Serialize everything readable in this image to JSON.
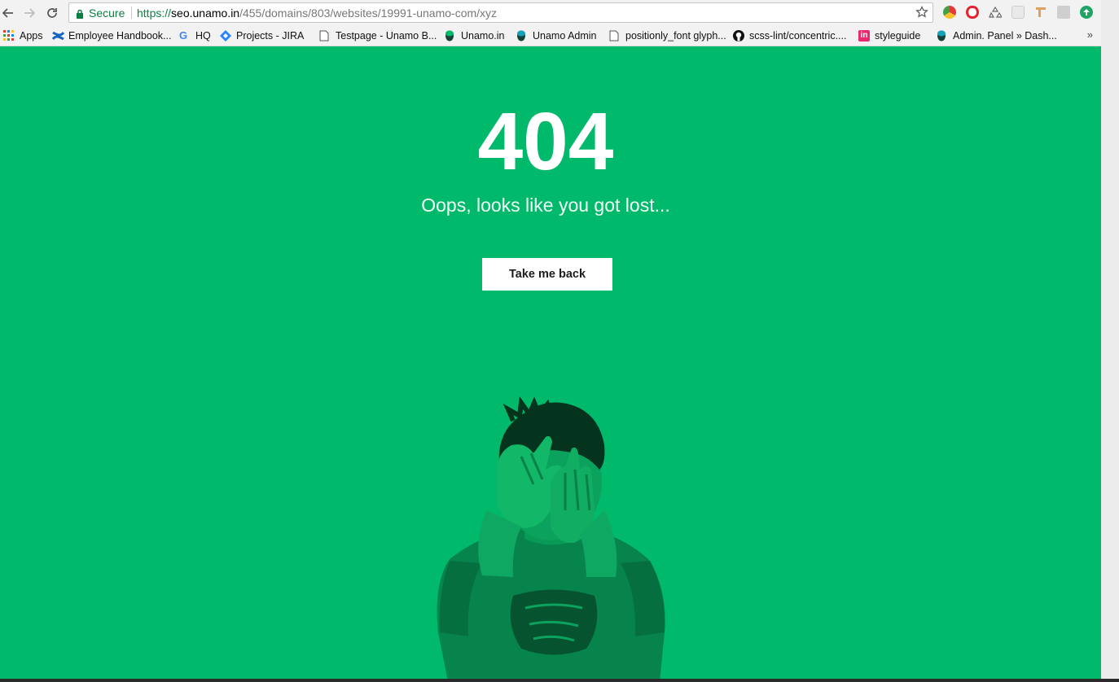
{
  "browser": {
    "secure_label": "Secure",
    "url_scheme": "https://",
    "url_host": "seo.unamo.in",
    "url_path": "/455/domains/803/websites/19991-unamo-com/xyz"
  },
  "bookmarks": [
    {
      "label": "Apps",
      "icon": "apps-grid-icon"
    },
    {
      "label": "Employee Handbook...",
      "icon": "confluence-icon"
    },
    {
      "label": "HQ",
      "icon": "google-icon"
    },
    {
      "label": "Projects - JIRA",
      "icon": "jira-icon"
    },
    {
      "label": "Testpage - Unamo B...",
      "icon": "page-icon"
    },
    {
      "label": "Unamo.in",
      "icon": "unamo-icon"
    },
    {
      "label": "Unamo Admin",
      "icon": "unamo-icon"
    },
    {
      "label": "positionly_font glyph...",
      "icon": "page-icon"
    },
    {
      "label": "scss-lint/concentric....",
      "icon": "github-icon"
    },
    {
      "label": "styleguide",
      "icon": "invision-icon"
    },
    {
      "label": "Admin. Panel » Dash...",
      "icon": "unamo-icon"
    }
  ],
  "page": {
    "error_code": "404",
    "message": "Oops, looks like you got lost...",
    "button_label": "Take me back"
  },
  "colors": {
    "background": "#00b96b",
    "button_bg": "#ffffff",
    "secure_green": "#0b8043"
  }
}
